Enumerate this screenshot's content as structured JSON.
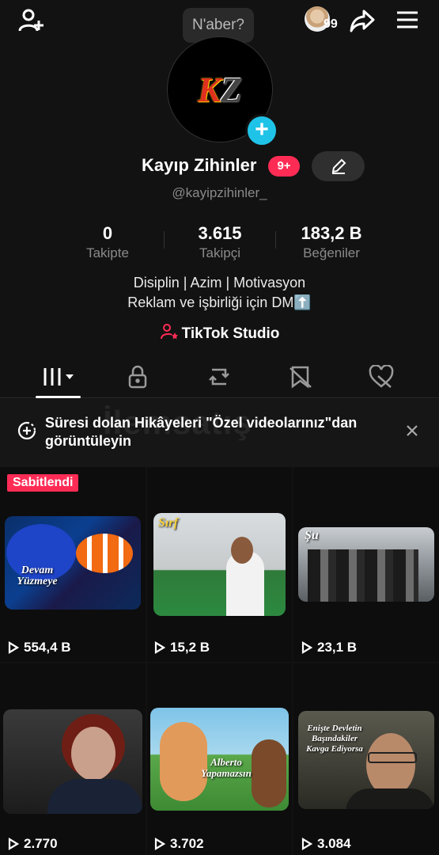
{
  "header": {
    "tooltip": "N'aber?",
    "notification_count": "99"
  },
  "profile": {
    "name": "Kayıp Zihinler",
    "badge": "9+",
    "handle": "@kayipzihinler_",
    "stats": [
      {
        "value": "0",
        "label": "Takipte"
      },
      {
        "value": "3.615",
        "label": "Takipçi"
      },
      {
        "value": "183,2 B",
        "label": "Beğeniler"
      }
    ],
    "bio_line1": "Disiplin | Azim | Motivasyon",
    "bio_line2": "Reklam ve işbirliği için DM⬆️",
    "studio_label": "TikTok Studio"
  },
  "banner": {
    "text": "Süresi dolan Hikâyeleri \"Özel videolarınız\"dan görüntüleyin"
  },
  "grid": {
    "pinned_label": "Sabitlendi",
    "videos": [
      {
        "views": "554,4 B",
        "overlay": "Devam Yüzmeye"
      },
      {
        "views": "15,2 B",
        "overlay": "Sırf"
      },
      {
        "views": "23,1 B",
        "overlay": "Şu"
      },
      {
        "views": "2.770",
        "overlay": ""
      },
      {
        "views": "3.702",
        "overlay": "Alberto Yapamazsın"
      },
      {
        "views": "3.084",
        "overlay": "Enişte Devletin Başındakiler Kavga Ediyorsa"
      }
    ]
  },
  "colors": {
    "accent": "#fe2c55",
    "add_button": "#20c3e8",
    "background": "#121212"
  }
}
